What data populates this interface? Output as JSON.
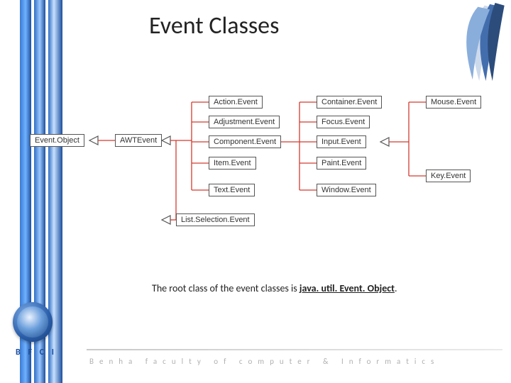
{
  "title": "Event Classes",
  "caption_prefix": "The root class of the event classes is ",
  "caption_class": "java. util. Event. Object",
  "caption_suffix": ".",
  "bfci": "B F C I",
  "footer": "Benha  faculty  of  computer  &  Informatics",
  "nodes": {
    "event_object": "Event.Object",
    "awt_event": "AWTEvent",
    "list_selection": "List.Selection.Event",
    "action_event": "Action.Event",
    "adjustment_event": "Adjustment.Event",
    "component_event": "Component.Event",
    "item_event": "Item.Event",
    "text_event": "Text.Event",
    "container_event": "Container.Event",
    "focus_event": "Focus.Event",
    "input_event": "Input.Event",
    "paint_event": "Paint.Event",
    "window_event": "Window.Event",
    "mouse_event": "Mouse.Event",
    "key_event": "Key.Event"
  }
}
